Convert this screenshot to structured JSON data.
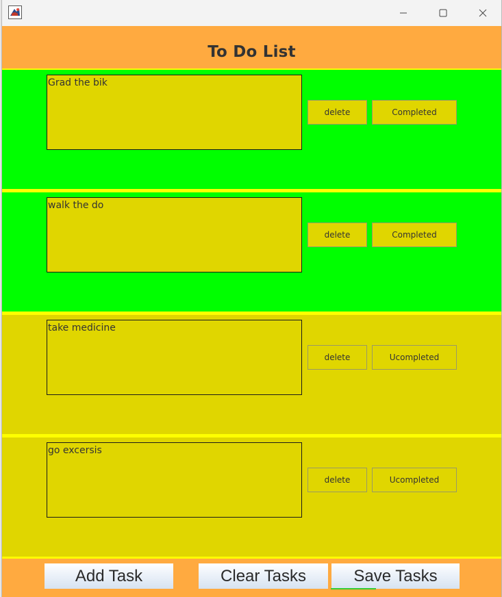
{
  "header": {
    "title": "To Do List"
  },
  "tasks": [
    {
      "text": "Grad the bik",
      "delete_label": "delete",
      "status_label": "Completed",
      "completed": true
    },
    {
      "text": "walk the do",
      "delete_label": "delete",
      "status_label": "Completed",
      "completed": true
    },
    {
      "text": "take medicine",
      "delete_label": "delete",
      "status_label": "Ucompleted",
      "completed": false
    },
    {
      "text": "go excersis",
      "delete_label": "delete",
      "status_label": "Ucompleted",
      "completed": false
    }
  ],
  "footer": {
    "add_label": "Add Task",
    "clear_label": "Clear Tasks",
    "save_label": "Save Tasks"
  },
  "colors": {
    "header_bg": "#ffaa40",
    "completed_bg": "#00ff00",
    "pending_bg": "#e0d600",
    "separator": "#ffff00"
  }
}
